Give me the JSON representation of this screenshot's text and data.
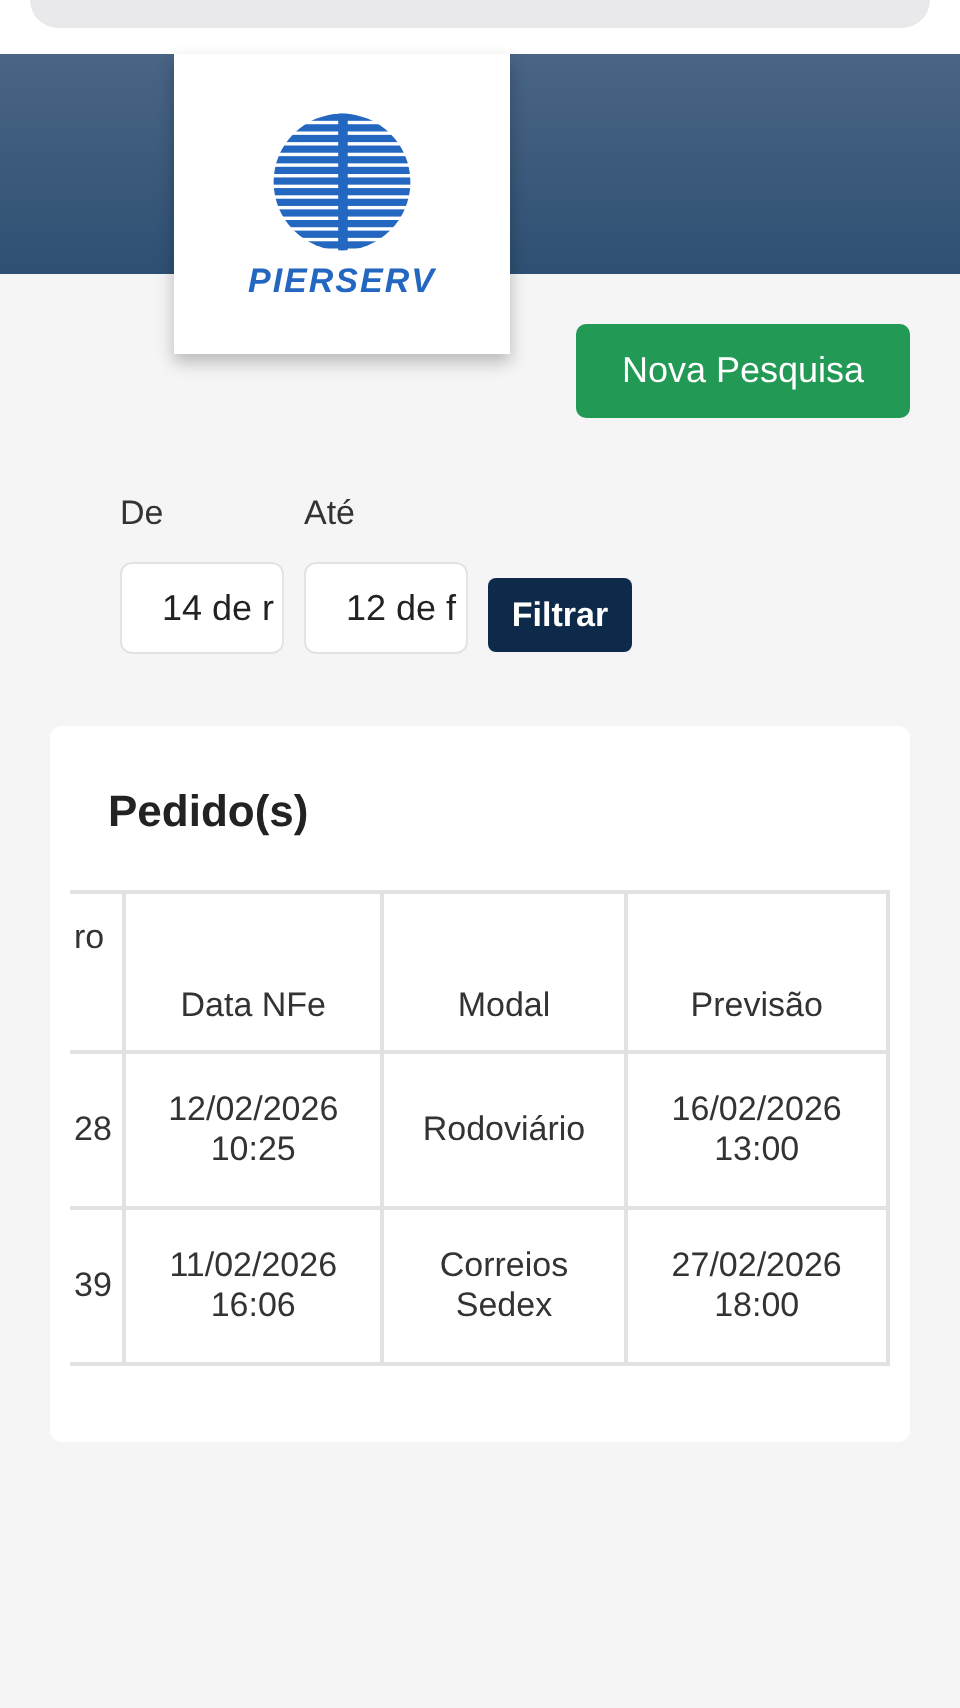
{
  "logo": {
    "text": "PIERSERV"
  },
  "new_search_button": "Nova Pesquisa",
  "filters": [
    {
      "label": "De",
      "value": "14 de r"
    },
    {
      "label": "Até",
      "value": "12 de f"
    }
  ],
  "filter_button": "Filtrar",
  "orders": {
    "title": "Pedido(s)",
    "columns": [
      "ro",
      "Data NFe",
      "Modal",
      "Previsão"
    ],
    "rows": [
      [
        "28",
        "12/02/2026 10:25",
        "Rodoviário",
        "16/02/2026 13:00"
      ],
      [
        "39",
        "11/02/2026 16:06",
        "Correios Sedex",
        "27/02/2026 18:00"
      ]
    ]
  }
}
